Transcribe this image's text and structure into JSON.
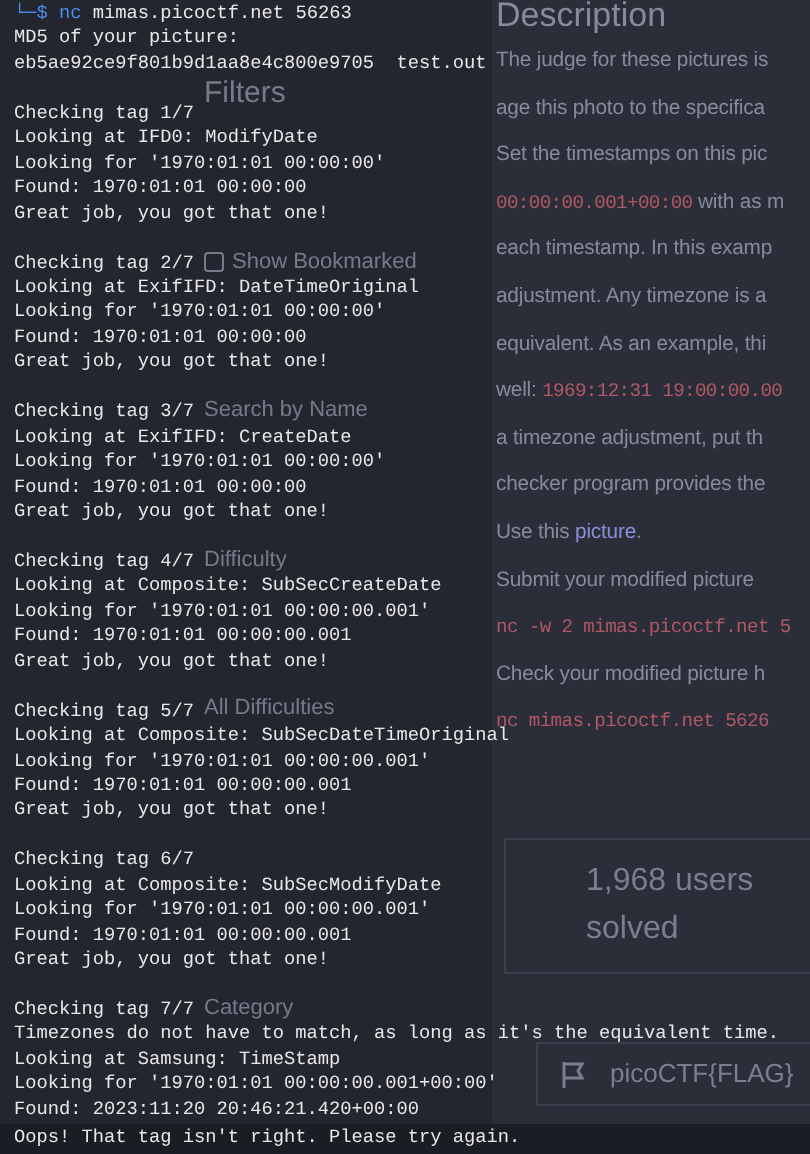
{
  "background_page": {
    "sidebar": {
      "title": "Filters",
      "bookmark_filter": {
        "label": "Show Bookmarked",
        "checked": false
      },
      "search": {
        "label": "Search by Name"
      },
      "difficulty": {
        "label": "Difficulty",
        "value": "All Difficulties"
      },
      "category": {
        "label": "Category"
      }
    },
    "description": {
      "title": "Description",
      "lines": [
        [
          {
            "kind": "text",
            "text": "The judge for these pictures is"
          }
        ],
        [
          {
            "kind": "text",
            "text": "age this photo to the specifica"
          }
        ],
        [
          {
            "kind": "text",
            "text": "Set the timestamps on this pic"
          }
        ],
        [
          {
            "kind": "code",
            "text": "00:00:00.001+00:00"
          },
          {
            "kind": "text",
            "text": " with as m"
          }
        ],
        [
          {
            "kind": "text",
            "text": "each timestamp. In this examp"
          }
        ],
        [
          {
            "kind": "text",
            "text": "adjustment. Any timezone is a"
          }
        ],
        [
          {
            "kind": "text",
            "text": "equivalent. As an example, thi"
          }
        ],
        [
          {
            "kind": "text",
            "text": "well: "
          },
          {
            "kind": "code",
            "text": "1969:12:31 19:00:00.00"
          }
        ],
        [
          {
            "kind": "text",
            "text": "a timezone adjustment, put th"
          }
        ],
        [
          {
            "kind": "text",
            "text": "checker program provides the"
          }
        ],
        [
          {
            "kind": "text",
            "text": "Use this "
          },
          {
            "kind": "link",
            "text": "picture"
          },
          {
            "kind": "text",
            "text": "."
          }
        ],
        [
          {
            "kind": "text",
            "text": "Submit your modified picture"
          }
        ],
        [
          {
            "kind": "code",
            "text": "nc -w 2 mimas.picoctf.net 5"
          }
        ],
        [
          {
            "kind": "text",
            "text": "Check your modified picture h"
          }
        ],
        [
          {
            "kind": "code",
            "text": "nc mimas.picoctf.net 5626"
          }
        ]
      ]
    },
    "solved": "1,968 users solved",
    "flag_field": {
      "placeholder": "picoCTF{FLAG}"
    }
  },
  "terminal": {
    "prompt": "└─$",
    "command": "nc",
    "arguments": "mimas.picoctf.net 56263",
    "header": [
      "MD5 of your picture:",
      "eb5ae92ce9f801b9d1aa8e4c800e9705  test.out"
    ],
    "blocks": [
      [
        "Checking tag 1/7",
        "Looking at IFD0: ModifyDate",
        "Looking for '1970:01:01 00:00:00'",
        "Found: 1970:01:01 00:00:00",
        "Great job, you got that one!"
      ],
      [
        "Checking tag 2/7",
        "Looking at ExifIFD: DateTimeOriginal",
        "Looking for '1970:01:01 00:00:00'",
        "Found: 1970:01:01 00:00:00",
        "Great job, you got that one!"
      ],
      [
        "Checking tag 3/7",
        "Looking at ExifIFD: CreateDate",
        "Looking for '1970:01:01 00:00:00'",
        "Found: 1970:01:01 00:00:00",
        "Great job, you got that one!"
      ],
      [
        "Checking tag 4/7",
        "Looking at Composite: SubSecCreateDate",
        "Looking for '1970:01:01 00:00:00.001'",
        "Found: 1970:01:01 00:00:00.001",
        "Great job, you got that one!"
      ],
      [
        "Checking tag 5/7",
        "Looking at Composite: SubSecDateTimeOriginal",
        "Looking for '1970:01:01 00:00:00.001'",
        "Found: 1970:01:01 00:00:00.001",
        "Great job, you got that one!"
      ],
      [
        "Checking tag 6/7",
        "Looking at Composite: SubSecModifyDate",
        "Looking for '1970:01:01 00:00:00.001'",
        "Found: 1970:01:01 00:00:00.001",
        "Great job, you got that one!"
      ],
      [
        "Checking tag 7/7",
        "Timezones do not have to match, as long as it's the equivalent time.",
        "Looking at Samsung: TimeStamp",
        "Looking for '1970:01:01 00:00:00.001+00:00'",
        "Found: 2023:11:20 20:46:21.420+00:00"
      ]
    ],
    "last_line": "Oops! That tag isn't right. Please try again."
  }
}
